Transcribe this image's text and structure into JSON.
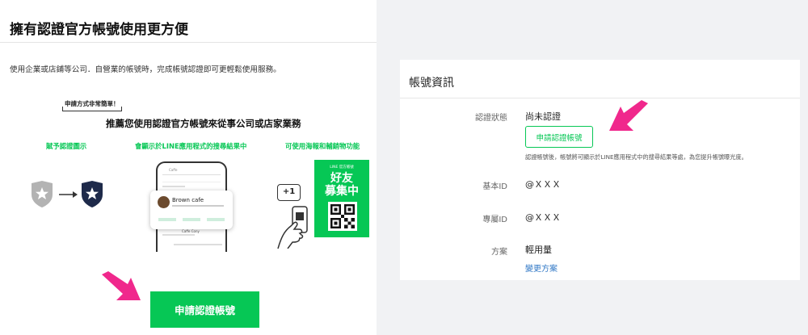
{
  "left_panel": {
    "title": "擁有認證官方帳號使用更方便",
    "description": "使用企業或店鋪等公司．自營業的帳號時，完成帳號認證即可更輕鬆使用服務。",
    "illustration": {
      "easy_tag": "申請方式非常簡單！",
      "recommend": "推薦您使用認證官方帳號來從事公司或店家業務",
      "features": [
        "賦予認證圖示",
        "會顯示於LINE應用程式的搜尋結果中",
        "可使用海報和輔銷物功能"
      ],
      "phone_search": "Caffe",
      "result_name": "Brown cafe",
      "phone_second_item": "Caffe Cony",
      "plus_badge": "+1",
      "poster_small": "LINE 官方帳號",
      "poster_big": [
        "好友",
        "募集中"
      ]
    },
    "apply_button": "申請認證帳號"
  },
  "right_panel": {
    "title": "帳號資訊",
    "rows": {
      "status_label": "認證狀態",
      "status_value": "尚未認證",
      "apply_button": "申請認證帳號",
      "note": "認證帳號後，帳號將可顯示於LINE應用程式中的搜尋結果等處，為您提升帳號曝光度。",
      "basic_id_label": "基本ID",
      "basic_id_value": "@ＸＸＸ",
      "premium_id_label": "專屬ID",
      "premium_id_value": "@ＸＸＸ",
      "plan_label": "方案",
      "plan_value": "輕用量",
      "change_plan": "變更方案"
    }
  },
  "colors": {
    "line_green": "#06c755",
    "arrow_pink": "#f0288c",
    "link_blue": "#3178c6",
    "shield_gray": "#b3b3b3",
    "shield_navy": "#1e2a4a"
  }
}
